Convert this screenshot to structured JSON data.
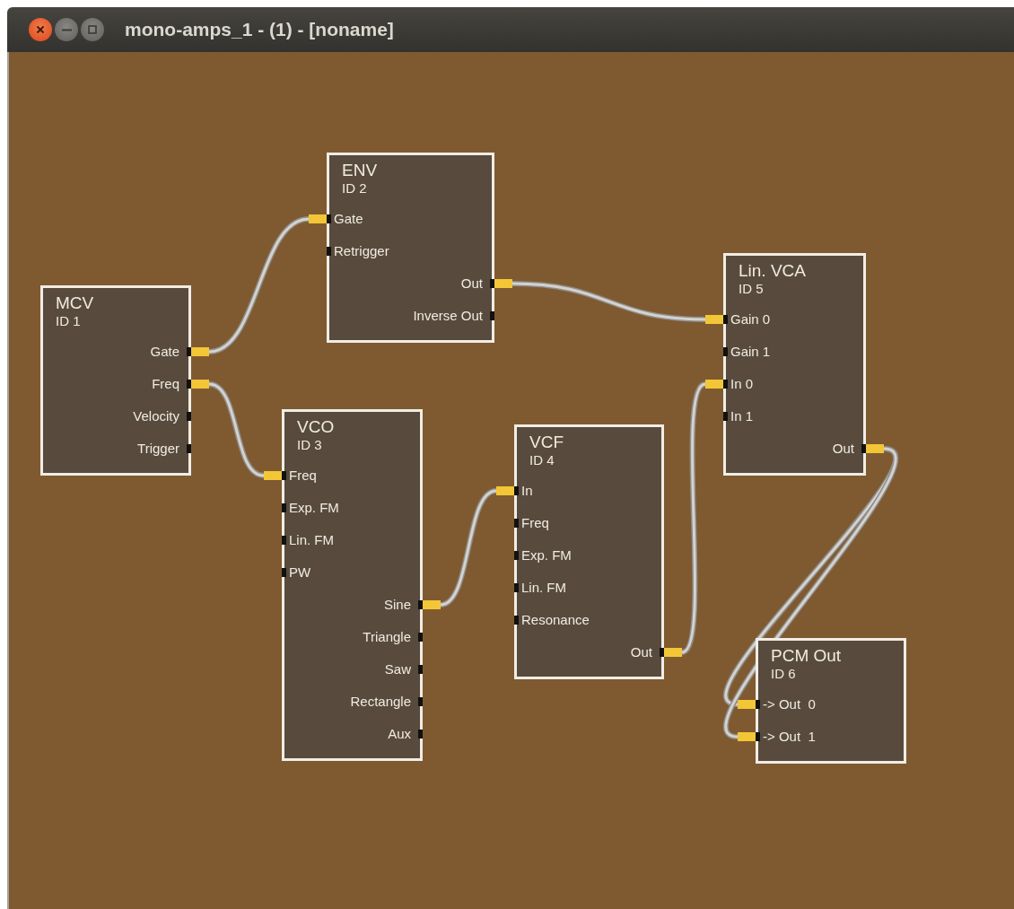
{
  "window": {
    "title": "mono-amps_1 - (1) - [noname]"
  },
  "modules": [
    {
      "name": "MCV",
      "id_label": "ID 1",
      "outputs": [
        {
          "label": "Gate",
          "connected": true
        },
        {
          "label": "Freq",
          "connected": true
        },
        {
          "label": "Velocity",
          "connected": false
        },
        {
          "label": "Trigger",
          "connected": false
        }
      ]
    },
    {
      "name": "ENV",
      "id_label": "ID 2",
      "inputs": [
        {
          "label": "Gate",
          "connected": true
        },
        {
          "label": "Retrigger",
          "connected": false
        }
      ],
      "outputs": [
        {
          "label": "Out",
          "connected": true
        },
        {
          "label": "Inverse Out",
          "connected": false
        }
      ]
    },
    {
      "name": "VCO",
      "id_label": "ID 3",
      "inputs": [
        {
          "label": "Freq",
          "connected": true
        },
        {
          "label": "Exp. FM",
          "connected": false
        },
        {
          "label": "Lin. FM",
          "connected": false
        },
        {
          "label": "PW",
          "connected": false
        }
      ],
      "outputs": [
        {
          "label": "Sine",
          "connected": true
        },
        {
          "label": "Triangle",
          "connected": false
        },
        {
          "label": "Saw",
          "connected": false
        },
        {
          "label": "Rectangle",
          "connected": false
        },
        {
          "label": "Aux",
          "connected": false
        }
      ]
    },
    {
      "name": "VCF",
      "id_label": "ID 4",
      "inputs": [
        {
          "label": "In",
          "connected": true
        },
        {
          "label": "Freq",
          "connected": false
        },
        {
          "label": "Exp. FM",
          "connected": false
        },
        {
          "label": "Lin. FM",
          "connected": false
        },
        {
          "label": "Resonance",
          "connected": false
        }
      ],
      "outputs": [
        {
          "label": "Out",
          "connected": true
        }
      ]
    },
    {
      "name": "Lin. VCA",
      "id_label": "ID 5",
      "inputs": [
        {
          "label": "Gain 0",
          "connected": true
        },
        {
          "label": "Gain 1",
          "connected": false
        },
        {
          "label": "In 0",
          "connected": true
        },
        {
          "label": "In 1",
          "connected": false
        }
      ],
      "outputs": [
        {
          "label": "Out",
          "connected": true
        }
      ]
    },
    {
      "name": "PCM Out",
      "id_label": "ID 6",
      "inputs": [
        {
          "label": "-> Out  0",
          "connected": true
        },
        {
          "label": "-> Out  1",
          "connected": true
        }
      ]
    }
  ]
}
